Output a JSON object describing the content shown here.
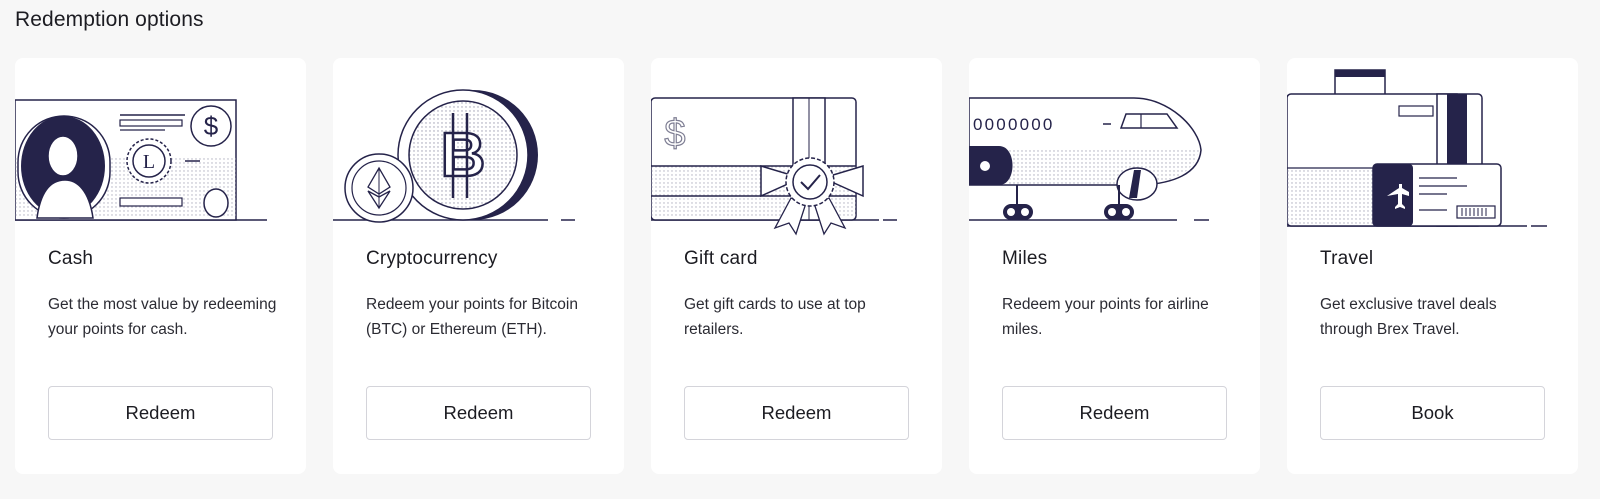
{
  "section": {
    "title": "Redemption options"
  },
  "cards": [
    {
      "title": "Cash",
      "description": "Get the most value by redeeming your points for cash.",
      "button_label": "Redeem",
      "illustration": "cash-bill-illustration"
    },
    {
      "title": "Cryptocurrency",
      "description": "Redeem your points for Bitcoin (BTC) or Ethereum (ETH).",
      "button_label": "Redeem",
      "illustration": "crypto-coins-illustration"
    },
    {
      "title": "Gift card",
      "description": "Get gift cards to use at top retailers.",
      "button_label": "Redeem",
      "illustration": "gift-card-illustration"
    },
    {
      "title": "Miles",
      "description": "Redeem your points for airline miles.",
      "button_label": "Redeem",
      "illustration": "airplane-illustration"
    },
    {
      "title": "Travel",
      "description": "Get exclusive travel deals through Brex Travel.",
      "button_label": "Book",
      "illustration": "luggage-boarding-pass-illustration"
    }
  ],
  "illustration_text": {
    "cash_letter": "L",
    "cash_symbol": "$",
    "crypto_symbol": "B",
    "gift_symbol": "$",
    "miles_windows": "0000000"
  },
  "colors": {
    "background": "#f7f7f7",
    "card": "#ffffff",
    "ink": "#25234a",
    "button_border": "#d4d4da"
  }
}
